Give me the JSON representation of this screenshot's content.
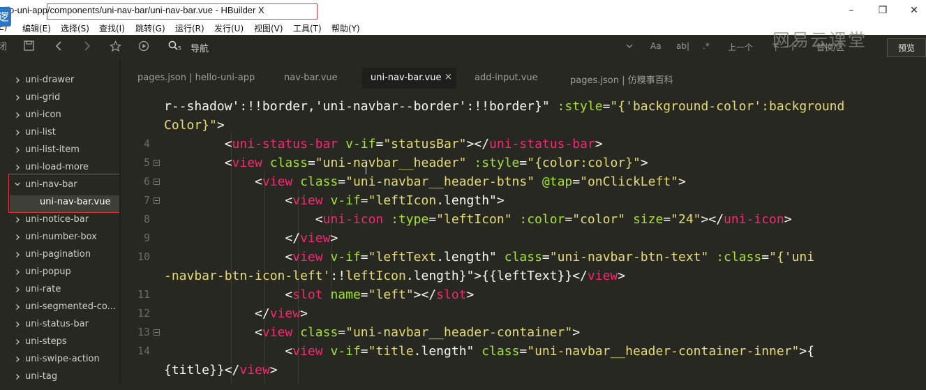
{
  "window": {
    "app_logo": "逻",
    "title": "ello-uni-app/components/uni-nav-bar/uni-nav-bar.vue - HBuilder X",
    "controls": {
      "minimize": "–",
      "restore": "❐",
      "close": "✕"
    }
  },
  "menu": [
    "E)",
    "编辑(E)",
    "选择(S)",
    "查找(I)",
    "跳转(G)",
    "运行(R)",
    "发行(U)",
    "视图(V)",
    "工具(T)",
    "帮助(Y)"
  ],
  "toolbar": {
    "search_label": "导航",
    "left_partial": "闭",
    "font_case": "Aa",
    "word": "ab|",
    "regex": ".*",
    "prev": "上一个",
    "next": "下一个",
    "replace": "替换/区",
    "preview": "预览",
    "watermark": "网易云课堂"
  },
  "sidebar": {
    "items": [
      {
        "label": "uni-drawer",
        "expanded": false
      },
      {
        "label": "uni-grid",
        "expanded": false
      },
      {
        "label": "uni-icon",
        "expanded": false
      },
      {
        "label": "uni-list",
        "expanded": false
      },
      {
        "label": "uni-list-item",
        "expanded": false
      },
      {
        "label": "uni-load-more",
        "expanded": false
      },
      {
        "label": "uni-nav-bar",
        "expanded": true
      },
      {
        "label": "uni-nav-bar.vue",
        "child": true,
        "selected": true
      },
      {
        "label": "uni-notice-bar",
        "expanded": false
      },
      {
        "label": "uni-number-box",
        "expanded": false
      },
      {
        "label": "uni-pagination",
        "expanded": false
      },
      {
        "label": "uni-popup",
        "expanded": false
      },
      {
        "label": "uni-rate",
        "expanded": false
      },
      {
        "label": "uni-segmented-co...",
        "expanded": false
      },
      {
        "label": "uni-status-bar",
        "expanded": false
      },
      {
        "label": "uni-steps",
        "expanded": false
      },
      {
        "label": "uni-swipe-action",
        "expanded": false
      },
      {
        "label": "uni-tag",
        "expanded": false
      }
    ]
  },
  "tabs": [
    {
      "label": "pages.json | hello-uni-app",
      "active": false
    },
    {
      "label": "nav-bar.vue",
      "active": false
    },
    {
      "label": "uni-nav-bar.vue",
      "active": true,
      "close": "×"
    },
    {
      "label": "add-input.vue",
      "active": false
    },
    {
      "label": "pages.json | 仿糗事百科",
      "active": false
    }
  ],
  "editor": {
    "line_numbers": [
      "",
      "",
      "4",
      "5",
      "6",
      "7",
      "8",
      "9",
      "10",
      "",
      "11",
      "12",
      "13",
      "14",
      ""
    ],
    "colors": {
      "tag": "#f92672",
      "attr": "#a6e22e",
      "string": "#e6db74",
      "text": "#f8f8f2",
      "background": "#272822"
    }
  }
}
